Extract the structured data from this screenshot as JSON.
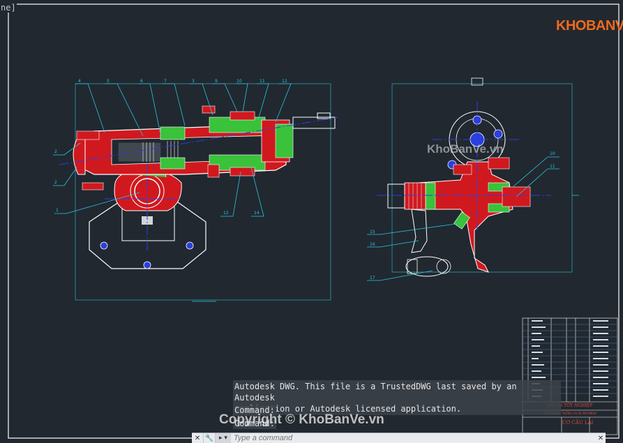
{
  "app": {
    "name_fragment": "ne]"
  },
  "logo": {
    "text_part1": "KHO",
    "text_part2": "BANVE"
  },
  "watermark": {
    "center": "KhoBanVe.vn",
    "copyright": "Copyright © KhoBanVe.vn"
  },
  "command": {
    "message_line1": "Autodesk DWG.  This file is a TrustedDWG last saved by an Autodesk",
    "message_line2": "application or Autodesk licensed application.",
    "prompt1": "Command:",
    "prompt2": "Command:",
    "input_placeholder": "Type a command"
  },
  "title_block": {
    "title": "ĐỒ ÁN TỐT NGHIỆP",
    "subtitle": "THIẾT KẾ HỆ THỐNG LÁI XE MUYINDAI",
    "drawing_name": "CƠ CẤU LÁI"
  },
  "callouts": {
    "left": [
      "4",
      "5",
      "6",
      "7",
      "3",
      "9",
      "10",
      "11",
      "12",
      "2",
      "2",
      "1",
      "12",
      "14"
    ],
    "right": [
      "10",
      "11",
      "15",
      "16",
      "17"
    ]
  },
  "colors": {
    "background": "#212830",
    "frame": "#ffffff",
    "leader": "#29c6e0",
    "section_red": "#d0191f",
    "section_green": "#39c23a",
    "outline": "#ffffff",
    "centerline": "#2a3fe0"
  },
  "icons": [
    "close-icon",
    "wrench-icon",
    "chevron-icon",
    "close-icon"
  ]
}
